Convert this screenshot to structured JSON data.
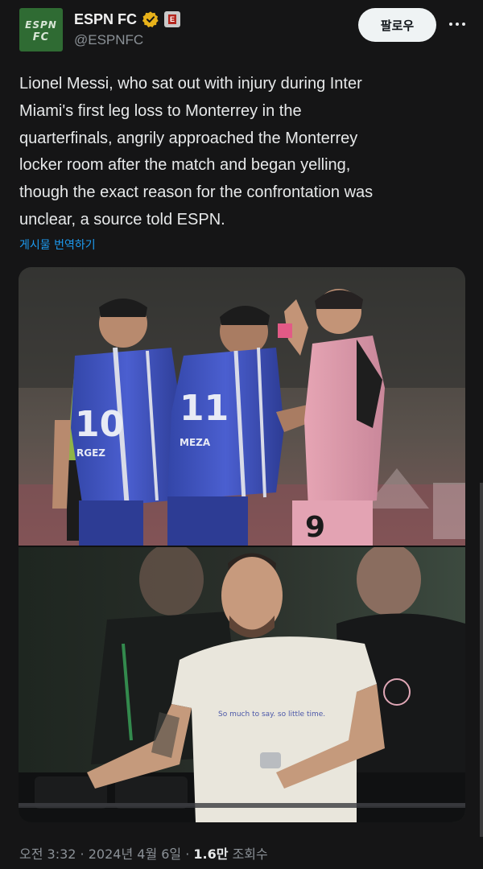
{
  "tweet": {
    "author": {
      "display_name": "ESPN FC",
      "handle": "@ESPNFC",
      "avatar_text_line1": "ESPN",
      "avatar_text_line2": "FC",
      "verified_icon": "verified-badge-icon",
      "affiliate_icon": "espn-affiliate-icon"
    },
    "follow_label": "팔로우",
    "more_icon": "more-horizontal-icon",
    "text": "Lionel Messi, who sat out with injury during Inter\nMiami's first leg loss to Monterrey in the\nquarterfinals, angrily approached the Monterrey\nlocker room after the match and began yelling,\nthough the exact reason for the confrontation was\nunclear, a source told ESPN.",
    "translate_label": "게시물 번역하기",
    "media": {
      "top_photo": {
        "jersey_numbers": [
          "10",
          "11",
          "9"
        ],
        "shirt_text": [
          "RGEZ",
          "MEZA"
        ]
      },
      "bottom_photo": {
        "shirt_text": "So much to say.\nso little time."
      }
    },
    "meta": {
      "time": "오전 3:32",
      "separator": " · ",
      "date": "2024년 4월 6일",
      "views_count": "1.6만",
      "views_label": " 조회수"
    }
  },
  "colors": {
    "background": "#151516",
    "text": "#e7e9ea",
    "secondary": "#8b9197",
    "link": "#1d9bf0",
    "verified": "#e8b21a",
    "follow_bg": "#eff3f4"
  }
}
